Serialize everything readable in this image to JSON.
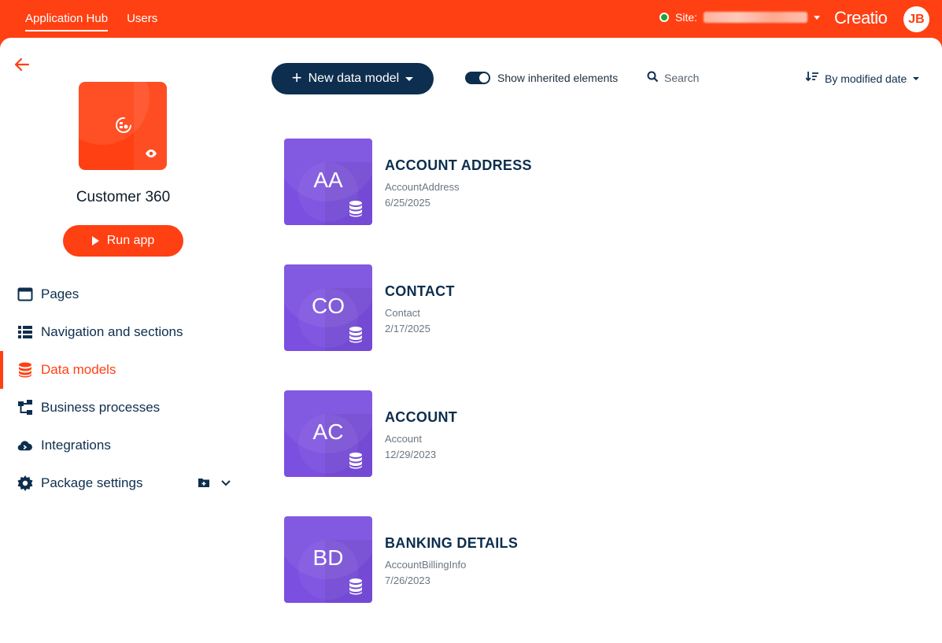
{
  "topbar": {
    "tabs": [
      {
        "label": "Application Hub",
        "active": true
      },
      {
        "label": "Users",
        "active": false
      }
    ],
    "site_label": "Site:",
    "logo_text": "Creatio",
    "avatar_initials": "JB",
    "status_color": "#19a53a",
    "brand_color": "#ff4013"
  },
  "app": {
    "name": "Customer 360",
    "run_label": "Run app"
  },
  "sidebar": {
    "items": [
      {
        "label": "Pages",
        "icon": "page-icon",
        "active": false
      },
      {
        "label": "Navigation and sections",
        "icon": "list-icon",
        "active": false
      },
      {
        "label": "Data models",
        "icon": "database-icon",
        "active": true
      },
      {
        "label": "Business processes",
        "icon": "process-icon",
        "active": false
      },
      {
        "label": "Integrations",
        "icon": "cloud-icon",
        "active": false
      },
      {
        "label": "Package settings",
        "icon": "gear-icon",
        "active": false
      }
    ]
  },
  "toolbar": {
    "new_label": "New data model",
    "toggle_label": "Show inherited elements",
    "toggle_on": true,
    "search_placeholder": "Search",
    "sort_label": "By modified date"
  },
  "cards": [
    {
      "abbr": "AA",
      "title": "ACCOUNT ADDRESS",
      "code": "AccountAddress",
      "date": "6/25/2025"
    },
    {
      "abbr": "CO",
      "title": "CONTACT",
      "code": "Contact",
      "date": "2/17/2025"
    },
    {
      "abbr": "AC",
      "title": "ACCOUNT",
      "code": "Account",
      "date": "12/29/2023"
    },
    {
      "abbr": "BD",
      "title": "BANKING DETAILS",
      "code": "AccountBillingInfo",
      "date": "7/26/2023"
    }
  ],
  "card_color": "#7b4fe0"
}
